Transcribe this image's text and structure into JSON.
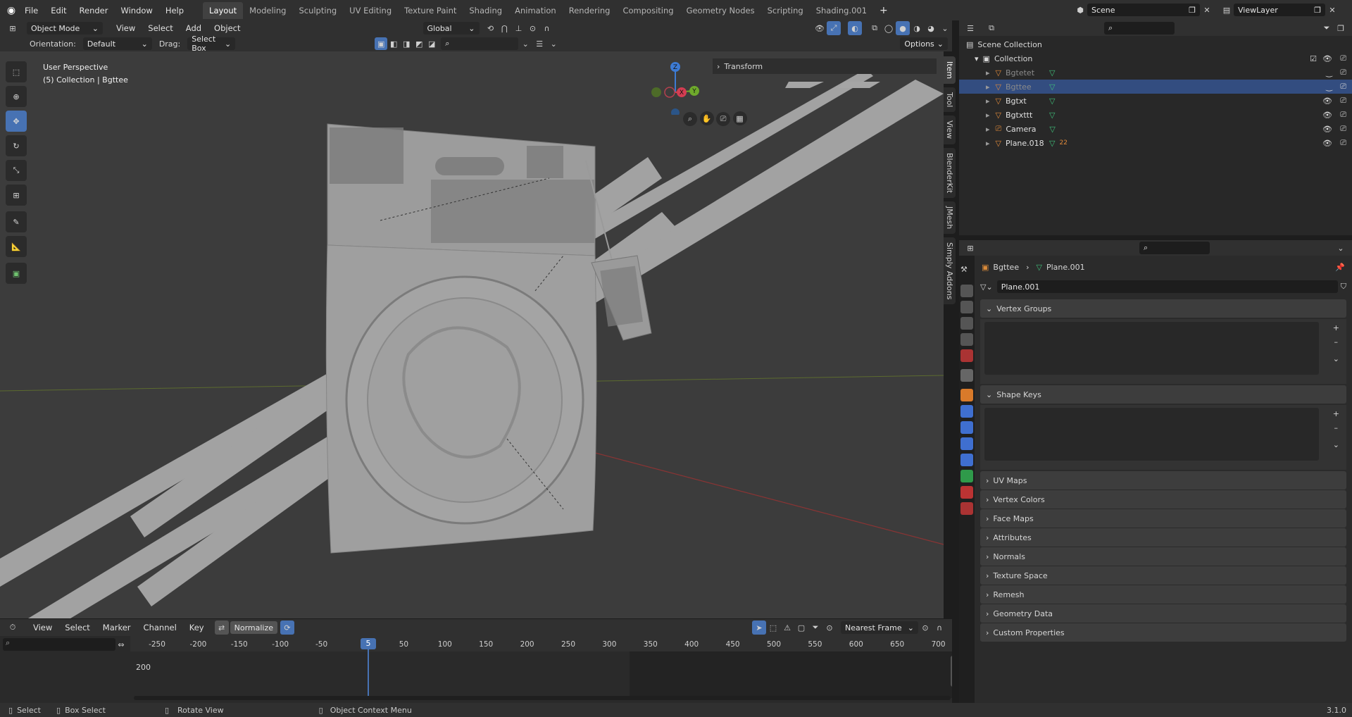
{
  "topbar": {
    "menus": [
      "File",
      "Edit",
      "Render",
      "Window",
      "Help"
    ],
    "workspaces": [
      "Layout",
      "Modeling",
      "Sculpting",
      "UV Editing",
      "Texture Paint",
      "Shading",
      "Animation",
      "Rendering",
      "Compositing",
      "Geometry Nodes",
      "Scripting",
      "Shading.001"
    ],
    "active_workspace": "Layout",
    "add_tab": "+",
    "scene": "Scene",
    "view_layer": "ViewLayer"
  },
  "viewport_header": {
    "mode": "Object Mode",
    "menus": [
      "View",
      "Select",
      "Add",
      "Object"
    ],
    "transform_orientation": "Global",
    "orientation_label": "Orientation:",
    "orientation_value": "Default",
    "drag_label": "Drag:",
    "drag_value": "Select Box",
    "options": "Options"
  },
  "viewport": {
    "perspective": "User Perspective",
    "collection_info": "(5) Collection | Bgttee",
    "transform_panel": "Transform",
    "gizmo": {
      "z": "Z",
      "x": "X",
      "y": "Y"
    }
  },
  "npanel_tabs": [
    "Item",
    "Tool",
    "View",
    "BlenderKit",
    "JMesh",
    "Simply Addons"
  ],
  "outliner": {
    "root": "Scene Collection",
    "collection": "Collection",
    "items": [
      {
        "name": "Bgtetet",
        "dim": true,
        "selected": false
      },
      {
        "name": "Bgttee",
        "dim": true,
        "selected": true
      },
      {
        "name": "Bgtxt",
        "dim": false,
        "selected": false
      },
      {
        "name": "Bgtxttt",
        "dim": false,
        "selected": false
      },
      {
        "name": "Camera",
        "dim": false,
        "selected": false
      },
      {
        "name": "Plane.018",
        "dim": false,
        "selected": false,
        "badge": "22"
      }
    ]
  },
  "properties": {
    "breadcrumb_object": "Bgttee",
    "breadcrumb_mesh": "Plane.001",
    "mesh_name": "Plane.001",
    "expanded_panels": [
      "Vertex Groups",
      "Shape Keys"
    ],
    "collapsed_panels": [
      "UV Maps",
      "Vertex Colors",
      "Face Maps",
      "Attributes",
      "Normals",
      "Texture Space",
      "Remesh",
      "Geometry Data",
      "Custom Properties"
    ]
  },
  "timeline": {
    "menus": [
      "View",
      "Select",
      "Marker",
      "Channel",
      "Key"
    ],
    "normalize": "Normalize",
    "snap": "Nearest Frame",
    "current_frame": "5",
    "ticks": [
      "-250",
      "-200",
      "-150",
      "-100",
      "-50",
      "50",
      "100",
      "150",
      "200",
      "250",
      "300",
      "350",
      "400",
      "450",
      "500",
      "550",
      "600",
      "650",
      "700"
    ],
    "row_label": "200"
  },
  "statusbar": {
    "select": "Select",
    "box_select": "Box Select",
    "rotate": "Rotate View",
    "context_menu": "Object Context Menu",
    "version": "3.1.0"
  }
}
